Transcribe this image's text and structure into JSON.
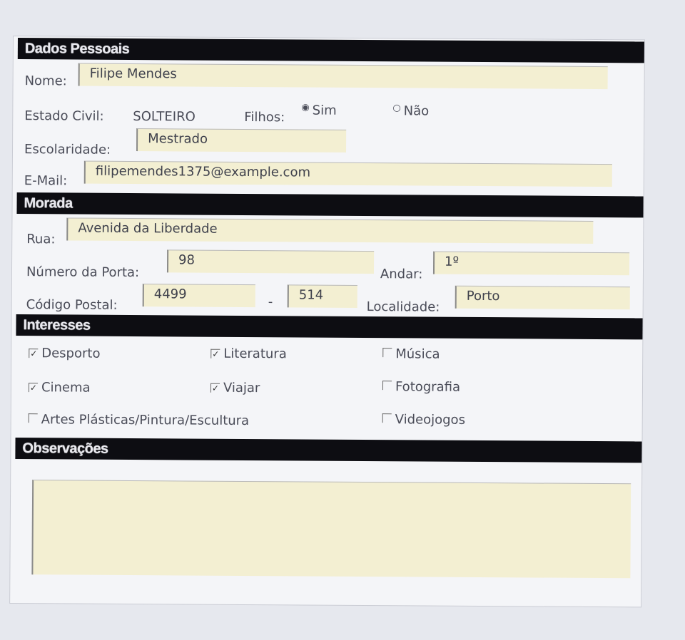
{
  "sections": {
    "personal": "Dados Pessoais",
    "address": "Morada",
    "interests": "Interesses",
    "notes": "Observações"
  },
  "personal": {
    "name_label": "Nome:",
    "name_value": "Filipe Mendes",
    "civil_label": "Estado Civil:",
    "civil_value": "SOLTEIRO",
    "children_label": "Filhos:",
    "children_yes": "Sim",
    "children_no": "Não",
    "children_selected": "Sim",
    "education_label": "Escolaridade:",
    "education_value": "Mestrado",
    "email_label": "E-Mail:",
    "email_value": "filipemendes1375@example.com"
  },
  "address": {
    "street_label": "Rua:",
    "street_value": "Avenida da Liberdade",
    "door_label": "Número da Porta:",
    "door_value": "98",
    "floor_label": "Andar:",
    "floor_value": "1º",
    "postal_label": "Código Postal:",
    "postal_part1": "4499",
    "postal_sep": "-",
    "postal_part2": "514",
    "city_label": "Localidade:",
    "city_value": "Porto"
  },
  "interests": [
    {
      "label": "Desporto",
      "checked": true
    },
    {
      "label": "Literatura",
      "checked": true
    },
    {
      "label": "Música",
      "checked": false
    },
    {
      "label": "Cinema",
      "checked": true
    },
    {
      "label": "Viajar",
      "checked": true
    },
    {
      "label": "Fotografia",
      "checked": false
    },
    {
      "label": "Artes Plásticas/Pintura/Escultura",
      "checked": false
    },
    {
      "label": "Videojogos",
      "checked": false
    }
  ],
  "notes": {
    "value": ""
  },
  "colors": {
    "header_bg": "#0d0d12",
    "field_bg": "#f3efd2"
  }
}
